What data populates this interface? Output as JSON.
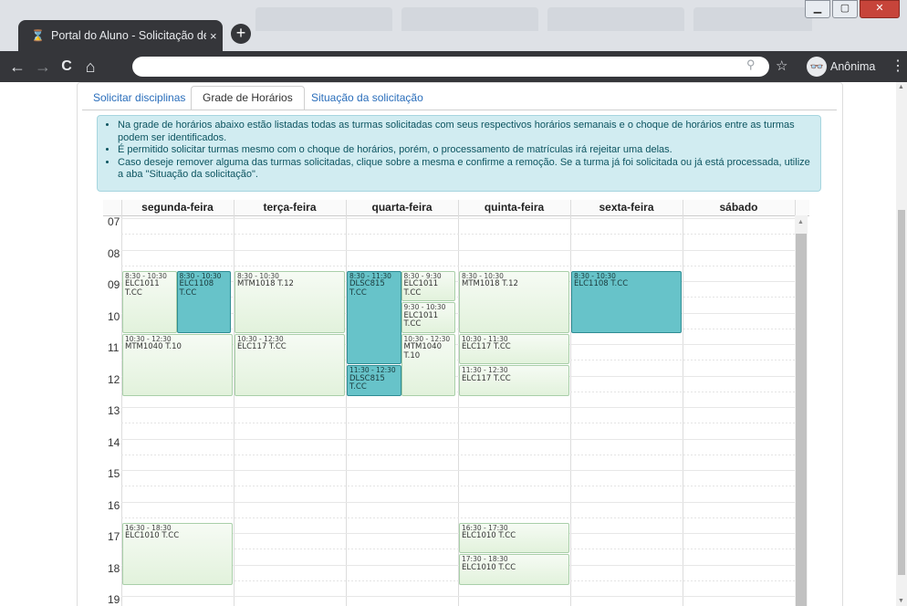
{
  "browser": {
    "tab_title": "Portal do Aluno - Solicitação de",
    "tab_close": "×",
    "new_tab": "+",
    "back": "←",
    "forward": "→",
    "reload": "C",
    "home": "⌂",
    "address": "",
    "incognito_label": "Anônima",
    "menu": "⋮"
  },
  "tabs": {
    "solicitar": "Solicitar disciplinas",
    "grade": "Grade de Horários",
    "situacao": "Situação da solicitação"
  },
  "info": [
    "Na grade de horários abaixo estão listadas todas as turmas solicitadas com seus respectivos horários semanais e o choque de horários entre as turmas podem ser identificados.",
    "É permitido solicitar turmas mesmo com o choque de horários, porém, o processamento de matrículas irá rejeitar uma delas.",
    "Caso deseje remover alguma das turmas solicitadas, clique sobre a mesma e confirme a remoção. Se a turma já foi solicitada ou já está processada, utilize a aba \"Situação da solicitação\"."
  ],
  "days": [
    "segunda-feira",
    "terça-feira",
    "quarta-feira",
    "quinta-feira",
    "sexta-feira",
    "sábado"
  ],
  "hours": [
    "07",
    "08",
    "09",
    "10",
    "11",
    "12",
    "13",
    "14",
    "15",
    "16",
    "17",
    "18",
    "19"
  ],
  "events": [
    {
      "day": 0,
      "start": 8.5,
      "end": 10.5,
      "time": "8:30 - 10:30",
      "course": "ELC1011 T.CC",
      "col": 0,
      "cols": 2,
      "selected": false
    },
    {
      "day": 0,
      "start": 8.5,
      "end": 10.5,
      "time": "8:30 - 10:30",
      "course": "ELC1108 T.CC",
      "col": 1,
      "cols": 2,
      "selected": true
    },
    {
      "day": 0,
      "start": 10.5,
      "end": 12.5,
      "time": "10:30 - 12:30",
      "course": "MTM1040 T.10",
      "col": 0,
      "cols": 1,
      "selected": false
    },
    {
      "day": 0,
      "start": 16.5,
      "end": 18.5,
      "time": "16:30 - 18:30",
      "course": "ELC1010 T.CC",
      "col": 0,
      "cols": 1,
      "selected": false
    },
    {
      "day": 1,
      "start": 8.5,
      "end": 10.5,
      "time": "8:30 - 10:30",
      "course": "MTM1018 T.12",
      "col": 0,
      "cols": 1,
      "selected": false
    },
    {
      "day": 1,
      "start": 10.5,
      "end": 12.5,
      "time": "10:30 - 12:30",
      "course": "ELC117 T.CC",
      "col": 0,
      "cols": 1,
      "selected": false
    },
    {
      "day": 2,
      "start": 8.5,
      "end": 11.5,
      "time": "8:30 - 11:30",
      "course": "DLSC815 T.CC",
      "col": 0,
      "cols": 2,
      "selected": true
    },
    {
      "day": 2,
      "start": 11.5,
      "end": 12.5,
      "time": "11:30 - 12:30",
      "course": "DLSC815 T.CC",
      "col": 0,
      "cols": 2,
      "selected": true
    },
    {
      "day": 2,
      "start": 8.5,
      "end": 9.5,
      "time": "8:30 - 9:30",
      "course": "ELC1011 T.CC",
      "col": 1,
      "cols": 2,
      "selected": false
    },
    {
      "day": 2,
      "start": 9.5,
      "end": 10.5,
      "time": "9:30 - 10:30",
      "course": "ELC1011 T.CC",
      "col": 1,
      "cols": 2,
      "selected": false
    },
    {
      "day": 2,
      "start": 10.5,
      "end": 12.5,
      "time": "10:30 - 12:30",
      "course": "MTM1040 T.10",
      "col": 1,
      "cols": 2,
      "selected": false
    },
    {
      "day": 3,
      "start": 8.5,
      "end": 10.5,
      "time": "8:30 - 10:30",
      "course": "MTM1018 T.12",
      "col": 0,
      "cols": 1,
      "selected": false
    },
    {
      "day": 3,
      "start": 10.5,
      "end": 11.5,
      "time": "10:30 - 11:30",
      "course": "ELC117 T.CC",
      "col": 0,
      "cols": 1,
      "selected": false
    },
    {
      "day": 3,
      "start": 11.5,
      "end": 12.5,
      "time": "11:30 - 12:30",
      "course": "ELC117 T.CC",
      "col": 0,
      "cols": 1,
      "selected": false
    },
    {
      "day": 3,
      "start": 16.5,
      "end": 17.5,
      "time": "16:30 - 17:30",
      "course": "ELC1010 T.CC",
      "col": 0,
      "cols": 1,
      "selected": false
    },
    {
      "day": 3,
      "start": 17.5,
      "end": 18.5,
      "time": "17:30 - 18:30",
      "course": "ELC1010 T.CC",
      "col": 0,
      "cols": 1,
      "selected": false
    },
    {
      "day": 4,
      "start": 8.5,
      "end": 10.5,
      "time": "8:30 - 10:30",
      "course": "ELC1108 T.CC",
      "col": 0,
      "cols": 1,
      "selected": true
    }
  ],
  "colors": {
    "event_bg": "#e2f2dc",
    "event_selected_bg": "#67c3c9",
    "info_bg": "#d1ecf1",
    "link": "#2a6ebb"
  }
}
